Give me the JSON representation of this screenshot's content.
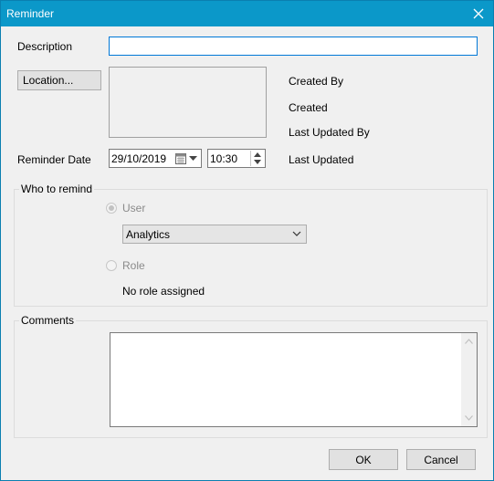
{
  "window": {
    "title": "Reminder"
  },
  "description": {
    "label": "Description",
    "value": ""
  },
  "location_button": "Location...",
  "info": {
    "created_by": "Created By",
    "created": "Created",
    "last_updated_by": "Last Updated By",
    "last_updated": "Last Updated"
  },
  "reminder": {
    "label": "Reminder Date",
    "date": "29/10/2019",
    "time": "10:30"
  },
  "who": {
    "title": "Who to remind",
    "user_label": "User",
    "user_selected": true,
    "user_value": "Analytics",
    "role_label": "Role",
    "role_selected": false,
    "role_value": "No role assigned"
  },
  "comments": {
    "title": "Comments",
    "value": ""
  },
  "buttons": {
    "ok": "OK",
    "cancel": "Cancel"
  },
  "colors": {
    "titlebar": "#0b98c9",
    "focus_border": "#0078d7"
  }
}
